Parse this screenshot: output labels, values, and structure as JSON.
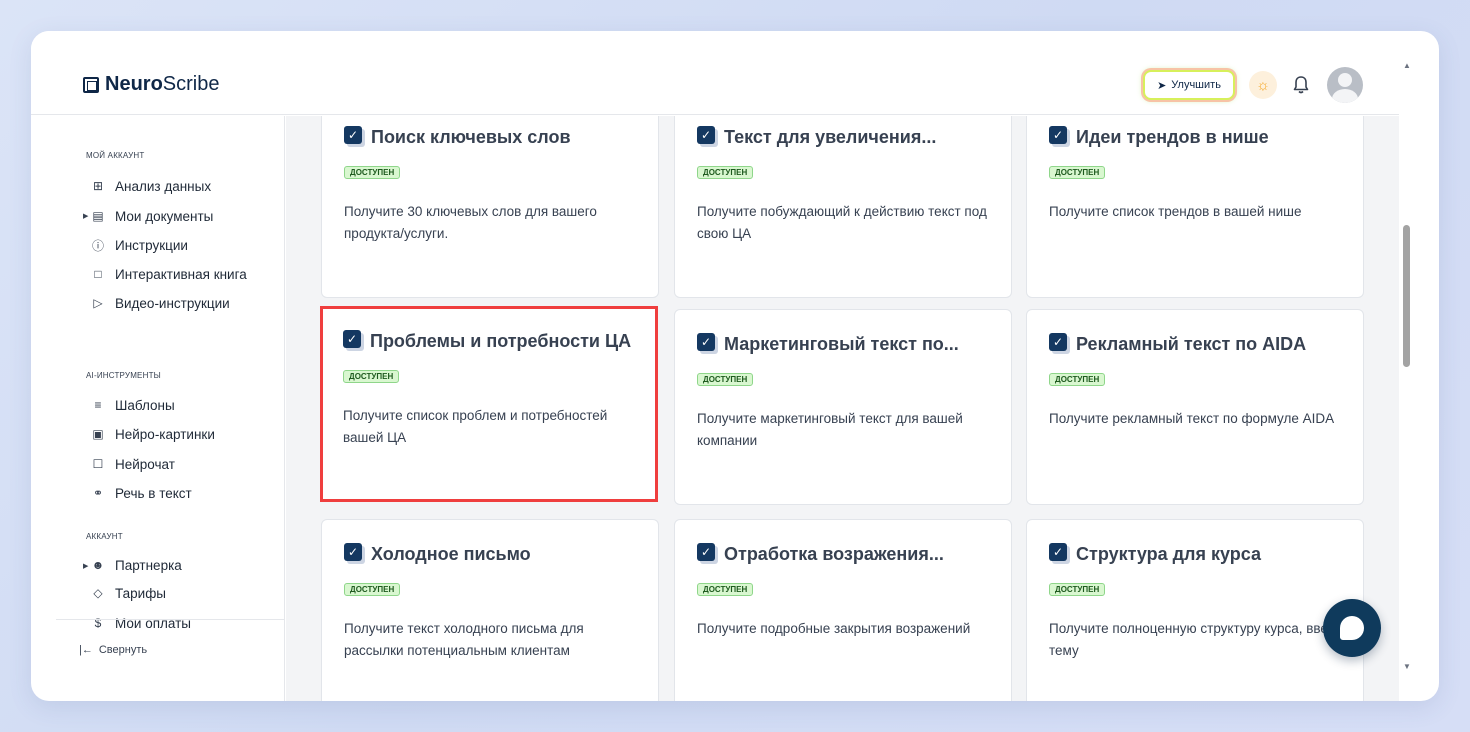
{
  "header": {
    "logo_bold": "Neuro",
    "logo_light": "Scribe",
    "upgrade_label": "Улучшить"
  },
  "sidebar": {
    "sections": [
      {
        "label": "МОЙ АККАУНТ",
        "items": [
          {
            "label": "Анализ данных",
            "icon": "grid-icon"
          },
          {
            "label": "Мои документы",
            "icon": "document-icon",
            "expandable": true
          },
          {
            "label": "Инструкции",
            "icon": "help-circle-icon"
          },
          {
            "label": "Интерактивная книга",
            "icon": "book-icon"
          },
          {
            "label": "Видео-инструкции",
            "icon": "video-icon"
          }
        ]
      },
      {
        "label": "AI-ИНСТРУМЕНТЫ",
        "items": [
          {
            "label": "Шаблоны",
            "icon": "layers-icon"
          },
          {
            "label": "Нейро-картинки",
            "icon": "image-icon"
          },
          {
            "label": "Нейрочат",
            "icon": "chat-icon"
          },
          {
            "label": "Речь в текст",
            "icon": "headphones-icon"
          }
        ]
      },
      {
        "label": "АККАУНТ",
        "items": [
          {
            "label": "Партнерка",
            "icon": "users-icon",
            "expandable": true
          },
          {
            "label": "Тарифы",
            "icon": "tag-icon"
          },
          {
            "label": "Мои оплаты",
            "icon": "dollar-icon"
          }
        ]
      }
    ],
    "collapse_label": "Свернуть"
  },
  "templates": [
    {
      "title": "Поиск ключевых слов",
      "badge": "ДОСТУПЕН",
      "desc": "Получите 30 ключевых слов для вашего продукта/услуги."
    },
    {
      "title": "Текст для увеличения...",
      "badge": "ДОСТУПЕН",
      "desc": "Получите побуждающий к действию текст под свою ЦА"
    },
    {
      "title": "Идеи трендов в нише",
      "badge": "ДОСТУПЕН",
      "desc": "Получите список трендов в вашей нише"
    },
    {
      "title": "Проблемы и потребности ЦА",
      "badge": "ДОСТУПЕН",
      "desc": "Получите список проблем и потребностей вашей ЦА"
    },
    {
      "title": "Маркетинговый текст по...",
      "badge": "ДОСТУПЕН",
      "desc": "Получите маркетинговый текст для вашей компании"
    },
    {
      "title": "Рекламный текст по AIDA",
      "badge": "ДОСТУПЕН",
      "desc": "Получите рекламный текст по формуле AIDA"
    },
    {
      "title": "Холодное письмо",
      "badge": "ДОСТУПЕН",
      "desc": "Получите текст холодного письма для рассылки потенциальным клиентам"
    },
    {
      "title": "Отработка возражения...",
      "badge": "ДОСТУПЕН",
      "desc": "Получите подробные закрытия возражений"
    },
    {
      "title": "Структура для курса",
      "badge": "ДОСТУПЕН",
      "desc": "Получите полноценную структуру курса, введя тему"
    }
  ],
  "colors": {
    "accent": "#143861",
    "highlight": "#ef3e3e",
    "badge_bg": "#d9f7d0"
  }
}
